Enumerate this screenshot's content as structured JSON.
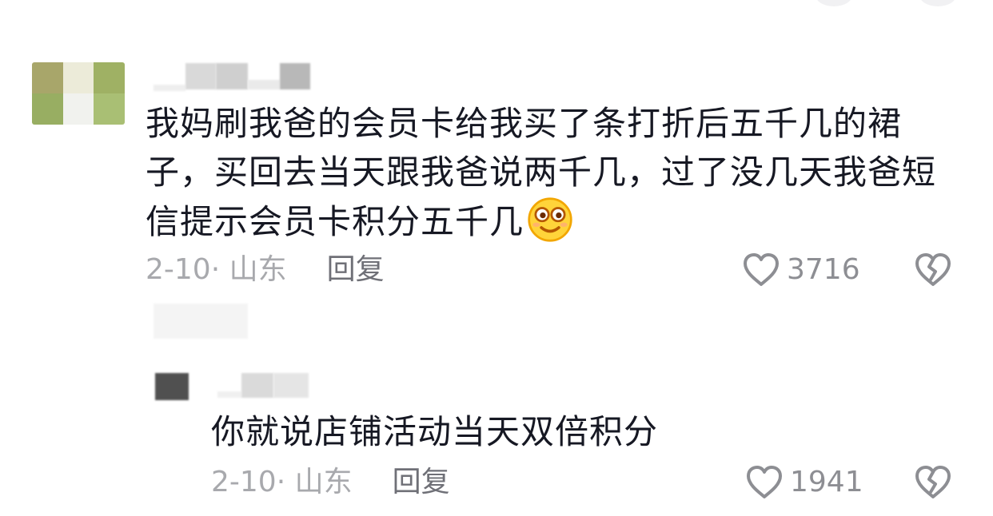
{
  "comment": {
    "text": "我妈刷我爸的会员卡给我买了条打折后五千几的裙子，买回去当天跟我爸说两千几，过了没几天我爸短信提示会员卡积分五千几",
    "emoji_icon": "smiling-face-icon",
    "date_location": "2-10· 山东",
    "reply_label": "回复",
    "like_count": "3716",
    "avatar_colors": [
      "#a8a66a",
      "#ecebd9",
      "#9fb164",
      "#98ae62",
      "#f1f2ee",
      "#a9bf74"
    ]
  },
  "reply": {
    "text": "你就说店铺活动当天双倍积分",
    "date_location": "2-10· 山东",
    "reply_label": "回复",
    "like_count": "1941"
  },
  "icons": {
    "like": "heart-outline-icon",
    "dislike": "broken-heart-icon"
  },
  "colors": {
    "text": "#161823",
    "meta": "#a8a9ad",
    "reply_link": "#6f7077",
    "icon": "#8d8e93"
  }
}
